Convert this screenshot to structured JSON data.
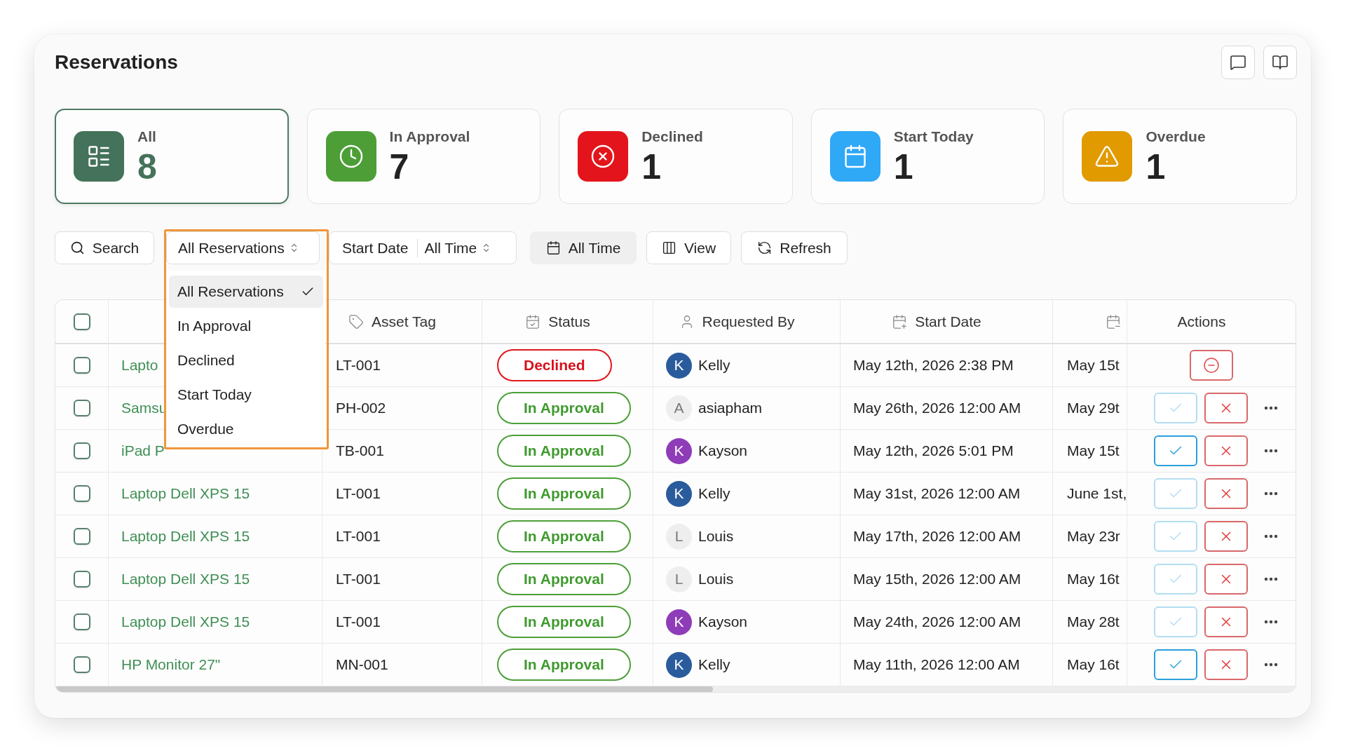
{
  "page": {
    "title": "Reservations"
  },
  "summary_cards": [
    {
      "kind": "all",
      "label": "All",
      "count": "8",
      "color": "#44725a",
      "selected": true
    },
    {
      "kind": "approval",
      "label": "In Approval",
      "count": "7",
      "color": "#4d9e37",
      "selected": false
    },
    {
      "kind": "declined",
      "label": "Declined",
      "count": "1",
      "color": "#e3141b",
      "selected": false
    },
    {
      "kind": "today",
      "label": "Start Today",
      "count": "1",
      "color": "#2fa8f6",
      "selected": false
    },
    {
      "kind": "overdue",
      "label": "Overdue",
      "count": "1",
      "color": "#e19a00",
      "selected": false
    }
  ],
  "toolbar": {
    "search": {
      "label": "Search"
    },
    "status_filter": {
      "value": "All Reservations",
      "expanded": true,
      "highlighted": true,
      "options": [
        {
          "label": "All Reservations",
          "selected": true
        },
        {
          "label": "In Approval",
          "selected": false
        },
        {
          "label": "Declined",
          "selected": false
        },
        {
          "label": "Start Today",
          "selected": false
        },
        {
          "label": "Overdue",
          "selected": false
        }
      ]
    },
    "date_filter": {
      "label": "Start Date",
      "value": "All Time"
    },
    "buttons": [
      {
        "kind": "range",
        "label": "All Time"
      },
      {
        "kind": "view",
        "label": "View"
      },
      {
        "kind": "refresh",
        "label": "Refresh"
      }
    ]
  },
  "table": {
    "select_all": {
      "checked": false
    },
    "columns": [
      {
        "kind": "tag",
        "label": "Asset Tag"
      },
      {
        "kind": "status",
        "label": "Status"
      },
      {
        "kind": "person",
        "label": "Requested By"
      },
      {
        "kind": "start",
        "label": "Start Date"
      },
      {
        "kind": "end"
      },
      {
        "kind": "plain",
        "label": "Actions"
      }
    ],
    "rows": [
      {
        "checked": false,
        "name": "Lapto",
        "asset_tag": "LT-001",
        "status": {
          "kind": "declined",
          "label": "Declined"
        },
        "requested_by": {
          "initial": "K",
          "name": "Kelly",
          "color": "#2a5b9c"
        },
        "start_date": "May 12th, 2026 2:38 PM",
        "column_7": "May 15t",
        "actions": {
          "kind": "revoke"
        }
      },
      {
        "checked": false,
        "name": "Samsu",
        "asset_tag": "PH-002",
        "status": {
          "kind": "approval",
          "label": "In Approval"
        },
        "requested_by": {
          "initial": "A",
          "name": "asiapham",
          "color": "#eeeeee"
        },
        "start_date": "May 26th, 2026 12:00 AM",
        "column_7": "May 29t",
        "actions": {
          "kind": "review",
          "approve_disabled": true
        }
      },
      {
        "checked": false,
        "name": "iPad P",
        "asset_tag": "TB-001",
        "status": {
          "kind": "approval",
          "label": "In Approval"
        },
        "requested_by": {
          "initial": "K",
          "name": "Kayson",
          "color": "#8e3cb7"
        },
        "start_date": "May 12th, 2026 5:01 PM",
        "column_7": "May 15t",
        "actions": {
          "kind": "review",
          "approve_disabled": false
        }
      },
      {
        "checked": false,
        "name": "Laptop Dell XPS 15",
        "asset_tag": "LT-001",
        "status": {
          "kind": "approval",
          "label": "In Approval"
        },
        "requested_by": {
          "initial": "K",
          "name": "Kelly",
          "color": "#2a5b9c"
        },
        "start_date": "May 31st, 2026 12:00 AM",
        "column_7": "June 1st,",
        "actions": {
          "kind": "review",
          "approve_disabled": true
        }
      },
      {
        "checked": false,
        "name": "Laptop Dell XPS 15",
        "asset_tag": "LT-001",
        "status": {
          "kind": "approval",
          "label": "In Approval"
        },
        "requested_by": {
          "initial": "L",
          "name": "Louis",
          "color": "#eeeeee"
        },
        "start_date": "May 17th, 2026 12:00 AM",
        "column_7": "May 23r",
        "actions": {
          "kind": "review",
          "approve_disabled": true
        }
      },
      {
        "checked": false,
        "name": "Laptop Dell XPS 15",
        "asset_tag": "LT-001",
        "status": {
          "kind": "approval",
          "label": "In Approval"
        },
        "requested_by": {
          "initial": "L",
          "name": "Louis",
          "color": "#eeeeee"
        },
        "start_date": "May 15th, 2026 12:00 AM",
        "column_7": "May 16t",
        "actions": {
          "kind": "review",
          "approve_disabled": true
        }
      },
      {
        "checked": false,
        "name": "Laptop Dell XPS 15",
        "asset_tag": "LT-001",
        "status": {
          "kind": "approval",
          "label": "In Approval"
        },
        "requested_by": {
          "initial": "K",
          "name": "Kayson",
          "color": "#8e3cb7"
        },
        "start_date": "May 24th, 2026 12:00 AM",
        "column_7": "May 28t",
        "actions": {
          "kind": "review",
          "approve_disabled": true
        }
      },
      {
        "checked": false,
        "name": "HP Monitor 27\"",
        "asset_tag": "MN-001",
        "status": {
          "kind": "approval",
          "label": "In Approval"
        },
        "requested_by": {
          "initial": "K",
          "name": "Kelly",
          "color": "#2a5b9c"
        },
        "start_date": "May 11th, 2026 12:00 AM",
        "column_7": "May 16t",
        "actions": {
          "kind": "review",
          "approve_disabled": false
        }
      }
    ]
  }
}
